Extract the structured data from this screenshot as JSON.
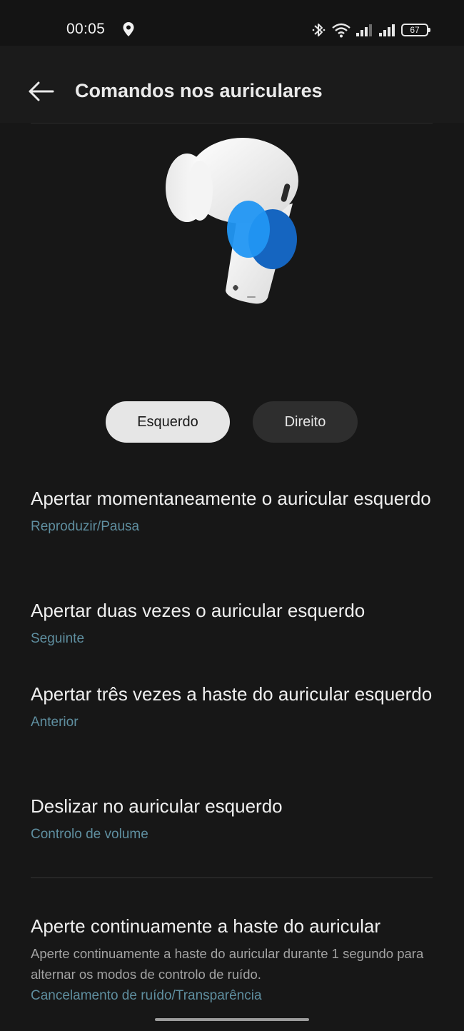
{
  "status_bar": {
    "time": "00:05",
    "battery_level": "67",
    "icons": [
      "location-icon",
      "bluetooth-icon",
      "wifi-icon",
      "signal-icon",
      "signal-icon",
      "battery-icon"
    ]
  },
  "header": {
    "title": "Comandos nos auriculares",
    "back_icon": "arrow-left-icon"
  },
  "earbud_selector": {
    "options": [
      "Esquerdo",
      "Direito"
    ],
    "selected": "Esquerdo"
  },
  "settings": [
    {
      "title": "Apertar momentaneamente o auricular esquerdo",
      "value": "Reproduzir/Pausa"
    },
    {
      "title": "Apertar duas vezes o auricular esquerdo",
      "value": "Seguinte"
    },
    {
      "title": "Apertar três vezes a haste do auricular esquerdo",
      "value": "Anterior"
    },
    {
      "title": "Deslizar no auricular esquerdo",
      "value": "Controlo de volume"
    }
  ],
  "noise_control": {
    "title": "Aperte continuamente a haste do auricular",
    "description": "Aperte continuamente a haste do auricular durante 1 segundo para alternar os modos de controlo de ruído.",
    "value": "Cancelamento de ruído/Transparência"
  },
  "colors": {
    "accent_value": "#5f8fa0",
    "highlight_blue": "#1e88e5",
    "background": "#171717"
  }
}
